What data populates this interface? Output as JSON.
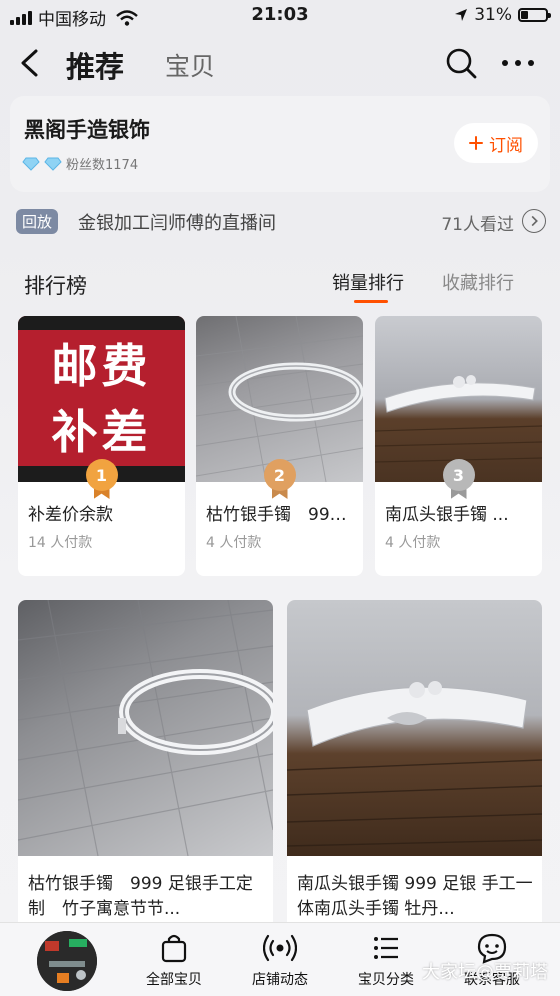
{
  "status_bar": {
    "carrier": "中国移动",
    "time": "21:03",
    "battery": "31%"
  },
  "nav": {
    "tab_active": "推荐",
    "tab_other": "宝贝"
  },
  "shop": {
    "name": "黑阁手造银饰",
    "fans": "粉丝数1174",
    "subscribe_label": "订阅"
  },
  "live": {
    "tag": "回放",
    "title": "金银加工闫师傅的直播间",
    "viewers": "71人看过"
  },
  "ranking": {
    "title": "排行榜",
    "tab_sales": "销量排行",
    "tab_favorites": "收藏排行",
    "items": [
      {
        "rank": "1",
        "image_text_1": "邮费",
        "image_text_2": "补差",
        "name": "补差价余款",
        "sold": "14 人付款"
      },
      {
        "rank": "2",
        "name": "枯竹银手镯　999...",
        "sold": "4 人付款"
      },
      {
        "rank": "3",
        "name": "南瓜头银手镯 ...",
        "sold": "4 人付款"
      }
    ]
  },
  "products": [
    {
      "name": "枯竹银手镯　999 足银手工定制　竹子寓意节节..."
    },
    {
      "name": "南瓜头银手镯 999 足银 手工一体南瓜头手镯 牡丹..."
    }
  ],
  "bottom_bar": {
    "items": [
      {
        "label": "全部宝贝",
        "icon": "bag-icon"
      },
      {
        "label": "店铺动态",
        "icon": "broadcast-icon"
      },
      {
        "label": "宝贝分类",
        "icon": "list-icon"
      },
      {
        "label": "联系客服",
        "icon": "chat-face-icon"
      }
    ]
  },
  "watermark": "大家坛@贾莉塔",
  "colors": {
    "accent": "#ff5000",
    "medal_gold": "#f1a340",
    "medal_bronze": "#e0a060",
    "medal_silver": "#b8b8b8"
  }
}
